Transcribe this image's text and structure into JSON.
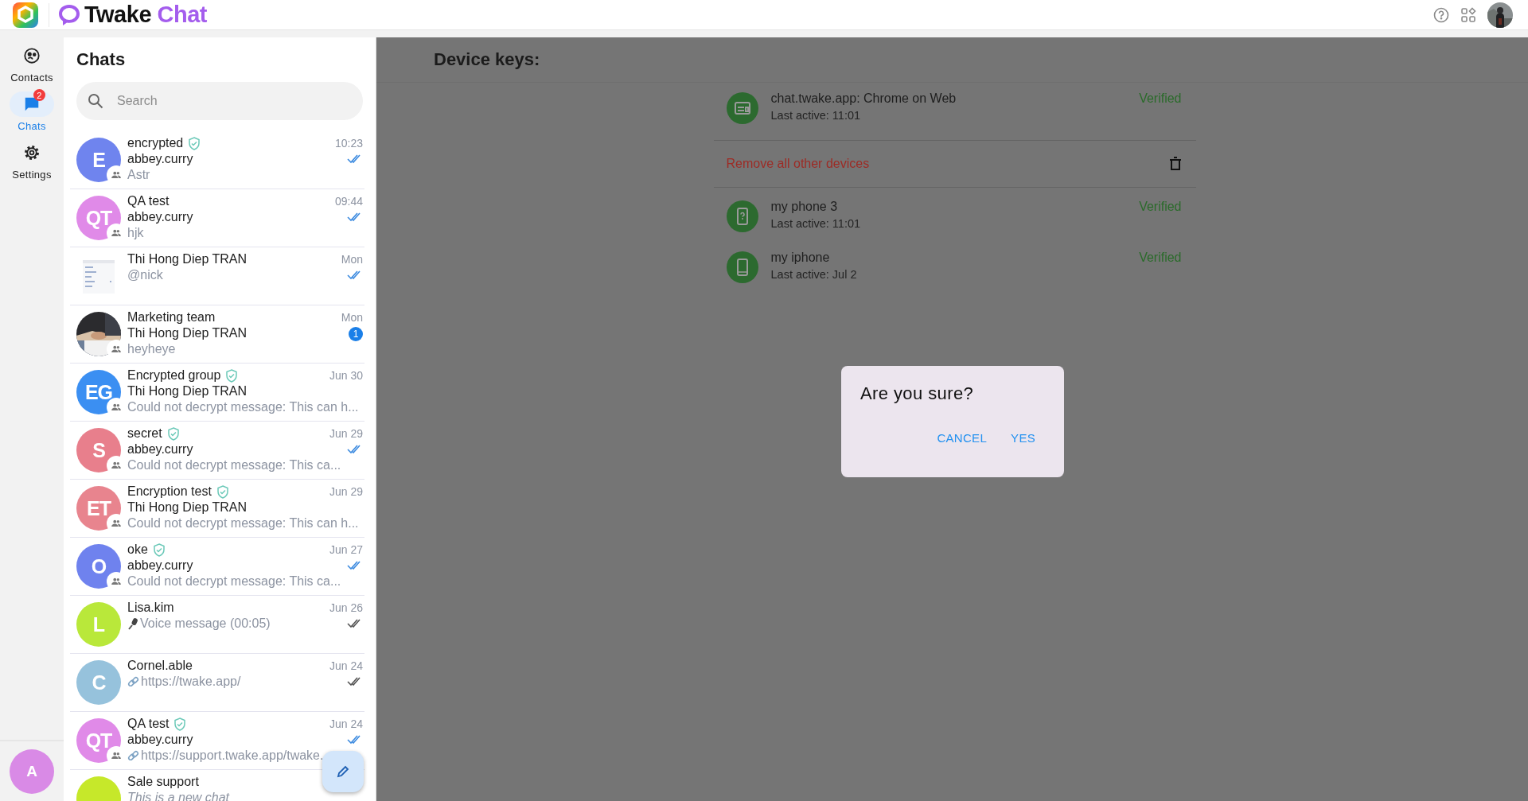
{
  "app": {
    "name_first": "Twake",
    "name_second": "Chat"
  },
  "nav": [
    {
      "kind": "contacts",
      "label": "Contacts",
      "selected": false
    },
    {
      "kind": "chats",
      "label": "Chats",
      "selected": true,
      "badge": "2"
    },
    {
      "kind": "settings",
      "label": "Settings",
      "selected": false
    }
  ],
  "account": {
    "initial": "A",
    "color": "#d98ae6"
  },
  "chats": {
    "title": "Chats",
    "search": {
      "placeholder": "Search"
    },
    "items": [
      {
        "kind": "text",
        "name": "encrypted",
        "encrypted": true,
        "sender": "abbey.curry",
        "preview": "Astr",
        "italic": false,
        "time": "10:23",
        "seen": true,
        "group": true,
        "avatar": {
          "kind": "initials",
          "text": "E",
          "color": "#6f84ee"
        }
      },
      {
        "kind": "text",
        "name": "QA test",
        "encrypted": false,
        "sender": "abbey.curry",
        "preview": "hjk",
        "italic": false,
        "time": "09:44",
        "seen": true,
        "group": true,
        "avatar": {
          "kind": "initials",
          "text": "QT",
          "color": "#e08ae8"
        }
      },
      {
        "kind": "text",
        "name": "Thi Hong Diep TRAN",
        "encrypted": false,
        "preview": "@nick",
        "italic": false,
        "time": "Mon",
        "seen": true,
        "group": false
      },
      {
        "kind": "text",
        "name": "Marketing team",
        "encrypted": false,
        "sender": "Thi Hong Diep TRAN",
        "preview": "heyheye",
        "italic": false,
        "time": "Mon",
        "unread": "1",
        "group": true
      },
      {
        "kind": "text",
        "name": "Encrypted group",
        "encrypted": true,
        "sender": "Thi Hong Diep TRAN",
        "preview": "Could not decrypt message: This can h...",
        "italic": false,
        "time": "Jun 30",
        "group": true,
        "avatar": {
          "kind": "initials",
          "text": "EG",
          "color": "#3b8ff2"
        }
      },
      {
        "kind": "text",
        "name": "secret",
        "encrypted": true,
        "sender": "abbey.curry",
        "preview": "Could not decrypt message: This ca...",
        "italic": false,
        "time": "Jun 29",
        "seen": true,
        "group": true,
        "avatar": {
          "kind": "initials",
          "text": "S",
          "color": "#e87f8c"
        }
      },
      {
        "kind": "text",
        "name": "Encryption test",
        "encrypted": true,
        "sender": "Thi Hong Diep TRAN",
        "preview": "Could not decrypt message: This can h...",
        "italic": false,
        "time": "Jun 29",
        "group": true,
        "avatar": {
          "kind": "initials",
          "text": "ET",
          "color": "#e8848e"
        }
      },
      {
        "kind": "text",
        "name": "oke",
        "encrypted": true,
        "sender": "abbey.curry",
        "preview": "Could not decrypt message: This ca...",
        "italic": false,
        "time": "Jun 27",
        "seen": true,
        "group": true,
        "avatar": {
          "kind": "initials",
          "text": "O",
          "color": "#6f82ee"
        }
      },
      {
        "kind": "voice",
        "name": "Lisa.kim",
        "encrypted": false,
        "preview": "Voice message (00:05)",
        "italic": false,
        "time": "Jun 26",
        "seen": false,
        "group": false,
        "avatar": {
          "kind": "initials",
          "text": "L",
          "color": "#b9e83a"
        }
      },
      {
        "kind": "link",
        "name": "Cornel.able",
        "encrypted": false,
        "preview": "https://twake.app/",
        "italic": false,
        "time": "Jun 24",
        "seen": false,
        "group": false,
        "avatar": {
          "kind": "initials",
          "text": "C",
          "color": "#96c2dc"
        }
      },
      {
        "kind": "link",
        "name": "QA test",
        "encrypted": true,
        "sender": "abbey.curry",
        "preview": "https://support.twake.app/twake.",
        "italic": false,
        "time": "Jun 24",
        "seen": true,
        "group": true,
        "avatar": {
          "kind": "initials",
          "text": "QT",
          "color": "#e08ae8"
        }
      },
      {
        "kind": "text",
        "name": "Sale support",
        "encrypted": false,
        "preview": "This is a new chat",
        "italic": true,
        "group": false,
        "avatar": {
          "kind": "initials",
          "color": "#c6e82a"
        }
      }
    ]
  },
  "device_keys": {
    "title": "Device keys:",
    "current": {
      "kind": "web",
      "name": "chat.twake.app: Chrome on Web",
      "last_active": "Last active: 11:01",
      "status": "Verified"
    },
    "remove_all": "Remove all other devices",
    "others": [
      {
        "kind": "unknown-phone",
        "name": "my phone 3",
        "last_active": "Last active: 11:01",
        "status": "Verified"
      },
      {
        "kind": "phone",
        "name": "my iphone",
        "last_active": "Last active: Jul 2",
        "status": "Verified"
      }
    ]
  },
  "dialog": {
    "title": "Are you sure?",
    "buttons": [
      "CANCEL",
      "YES"
    ]
  }
}
